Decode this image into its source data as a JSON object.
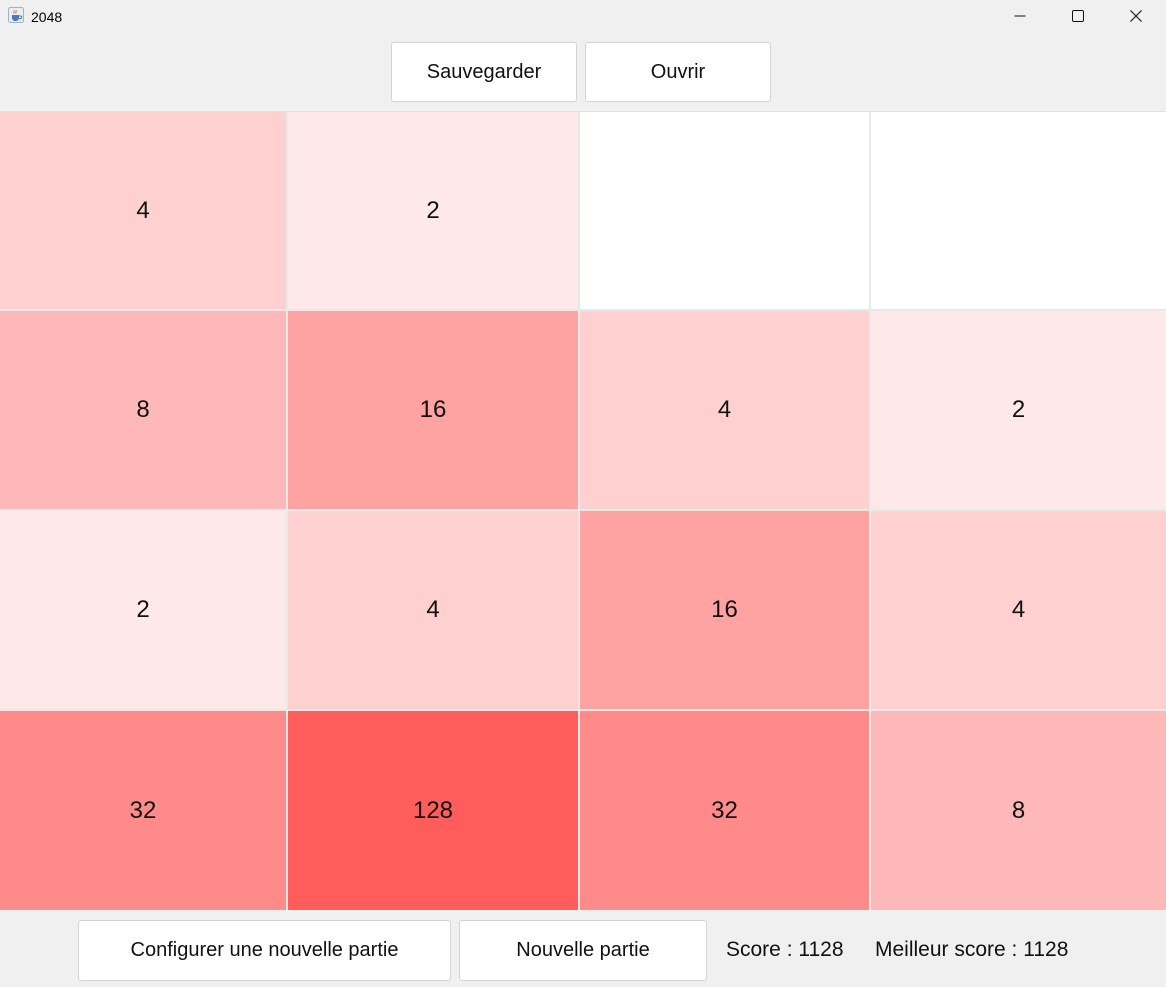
{
  "window": {
    "title": "2048",
    "icon": "java-cup-icon"
  },
  "toolbar": {
    "save_label": "Sauvegarder",
    "open_label": "Ouvrir"
  },
  "board": {
    "rows": [
      [
        {
          "value": "4",
          "color": "#ffd0d0"
        },
        {
          "value": "2",
          "color": "#ffe8e8"
        },
        {
          "value": "",
          "color": "#ffffff"
        },
        {
          "value": "",
          "color": "#ffffff"
        }
      ],
      [
        {
          "value": "8",
          "color": "#ffb8b8"
        },
        {
          "value": "16",
          "color": "#ffa2a2"
        },
        {
          "value": "4",
          "color": "#ffd0d0"
        },
        {
          "value": "2",
          "color": "#ffe8e8"
        }
      ],
      [
        {
          "value": "2",
          "color": "#ffe8e8"
        },
        {
          "value": "4",
          "color": "#ffd0d0"
        },
        {
          "value": "16",
          "color": "#ffa2a2"
        },
        {
          "value": "4",
          "color": "#ffd0d0"
        }
      ],
      [
        {
          "value": "32",
          "color": "#ff8a8a"
        },
        {
          "value": "128",
          "color": "#ff5c5c"
        },
        {
          "value": "32",
          "color": "#ff8a8a"
        },
        {
          "value": "8",
          "color": "#ffb8b8"
        }
      ]
    ]
  },
  "footer": {
    "configure_label": "Configurer une nouvelle partie",
    "new_game_label": "Nouvelle partie",
    "score_text": "Score : 1128",
    "best_score_text": "Meilleur score : 1128"
  }
}
